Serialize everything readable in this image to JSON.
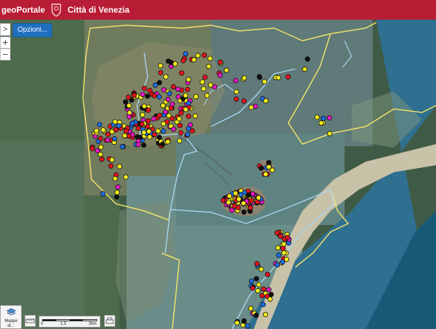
{
  "header": {
    "brand": "geoPortale",
    "city": "Città di Venezia",
    "crest_icon": "venice-crest-icon",
    "background": "#b81d35"
  },
  "controls": {
    "expand_icon": "chevron-right-icon",
    "options_label": "Opzioni...",
    "zoom_in": "+",
    "zoom_out": "−"
  },
  "basemap": {
    "label": "Mappe di...",
    "icon": "layers-icon"
  },
  "scalebar": {
    "labels": [
      "0",
      "1.5",
      "3km"
    ]
  },
  "legend_colors": {
    "red": "#e8141e",
    "yellow": "#f5ef1a",
    "magenta": "#e619c6",
    "blue": "#1f6ee6",
    "black": "#111111",
    "boundary_yellow": "#f3e26b",
    "boundary_blue": "#a8d6f2"
  }
}
